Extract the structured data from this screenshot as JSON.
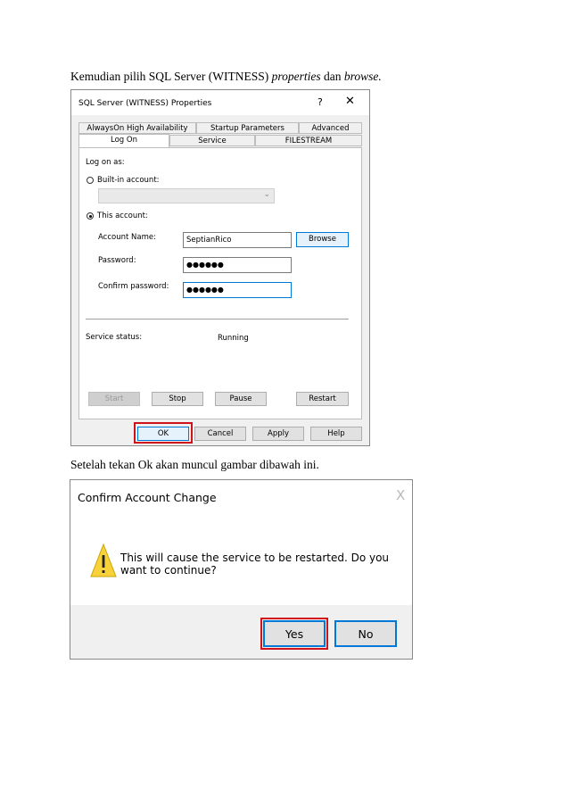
{
  "doc": {
    "para1": {
      "prefix": "Kemudian pilih SQL Server (WITNESS) ",
      "italic1": "properties",
      "middle": " dan ",
      "italic2": "browse."
    },
    "para2": "Setelah tekan Ok akan muncul gambar dibawah ini."
  },
  "dialog1": {
    "title": "SQL Server (WITNESS) Properties",
    "help": "?",
    "close": "✕",
    "tabs_row1": [
      "AlwaysOn High Availability",
      "Startup Parameters",
      "Advanced"
    ],
    "tabs_row2": [
      "Log On",
      "Service",
      "FILESTREAM"
    ],
    "log_on_as": "Log on as:",
    "builtin_label": "Built-in account:",
    "builtin_value": "",
    "this_account_label": "This account:",
    "account_name_label": "Account Name:",
    "account_name_value": "SeptianRico",
    "password_label": "Password:",
    "password_value": "●●●●●●",
    "confirm_label": "Confirm password:",
    "confirm_value": "●●●●●●",
    "browse": "Browse",
    "service_status_label": "Service status:",
    "service_status_value": "Running",
    "start": "Start",
    "stop": "Stop",
    "pause": "Pause",
    "restart": "Restart",
    "ok": "OK",
    "cancel": "Cancel",
    "apply": "Apply",
    "help_btn": "Help"
  },
  "dialog2": {
    "title": "Confirm Account Change",
    "close": "X",
    "message": "This will cause the service to be restarted. Do you want to continue?",
    "yes": "Yes",
    "no": "No"
  },
  "colors": {
    "highlight": "#d0121b",
    "focus": "#0078d7",
    "warning": "#f8d23a"
  }
}
